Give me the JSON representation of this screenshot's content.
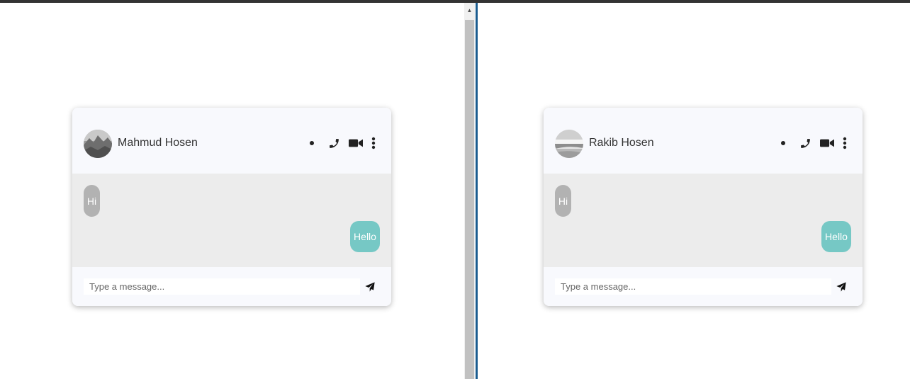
{
  "icons": {
    "status": "dot-icon",
    "call": "phone-icon",
    "video": "video-camera-icon",
    "menu": "more-vertical-icon",
    "send": "send-icon"
  },
  "colors": {
    "incoming_bubble": "#b2b2b2",
    "outgoing_bubble": "#76c8c5",
    "body_bg": "#ececec",
    "header_bg": "#f8f9fd",
    "divider": "#1a5c8f"
  },
  "left_chat": {
    "contact_name": "Mahmud Hosen",
    "messages": [
      {
        "direction": "incoming",
        "text": "Hi"
      },
      {
        "direction": "outgoing",
        "text": "Hello"
      }
    ],
    "input_placeholder": "Type a message..."
  },
  "right_chat": {
    "contact_name": "Rakib Hosen",
    "messages": [
      {
        "direction": "incoming",
        "text": "Hi"
      },
      {
        "direction": "outgoing",
        "text": "Hello"
      }
    ],
    "input_placeholder": "Type a message..."
  }
}
